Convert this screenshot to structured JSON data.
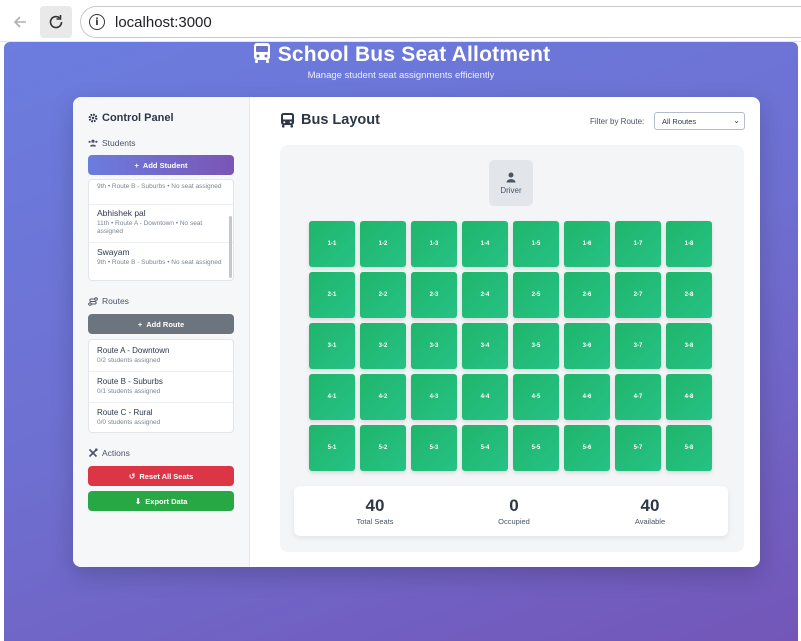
{
  "browser": {
    "url": "localhost:3000"
  },
  "header": {
    "title": "School Bus Seat Allotment",
    "subtitle": "Manage student seat assignments efficiently"
  },
  "sidebar": {
    "title": "Control Panel",
    "students_label": "Students",
    "add_student_label": "Add Student",
    "students": [
      {
        "name": "",
        "meta": "9th • Route B - Suburbs • No seat assigned"
      },
      {
        "name": "Abhishek pal",
        "meta": "11th • Route A - Downtown • No seat assigned"
      },
      {
        "name": "Swayam",
        "meta": "9th • Route B - Suburbs • No seat assigned"
      }
    ],
    "routes_label": "Routes",
    "add_route_label": "Add Route",
    "routes": [
      {
        "name": "Route A - Downtown",
        "meta": "0/2 students assigned"
      },
      {
        "name": "Route B - Suburbs",
        "meta": "0/1 students assigned"
      },
      {
        "name": "Route C - Rural",
        "meta": "0/0 students assigned"
      }
    ],
    "actions_label": "Actions",
    "reset_label": "Reset All Seats",
    "export_label": "Export Data"
  },
  "main": {
    "title": "Bus Layout",
    "filter_label": "Filter by Route:",
    "filter_value": "All Routes",
    "driver_label": "Driver",
    "seats": [
      [
        "1-1",
        "1-2",
        "1-3",
        "1-4",
        "1-5",
        "1-6",
        "1-7",
        "1-8"
      ],
      [
        "2-1",
        "2-2",
        "2-3",
        "2-4",
        "2-5",
        "2-6",
        "2-7",
        "2-8"
      ],
      [
        "3-1",
        "3-2",
        "3-3",
        "3-4",
        "3-5",
        "3-6",
        "3-7",
        "3-8"
      ],
      [
        "4-1",
        "4-2",
        "4-3",
        "4-4",
        "4-5",
        "4-6",
        "4-7",
        "4-8"
      ],
      [
        "5-1",
        "5-2",
        "5-3",
        "5-4",
        "5-5",
        "5-6",
        "5-7",
        "5-8"
      ]
    ],
    "stats": {
      "total_value": "40",
      "total_label": "Total Seats",
      "occupied_value": "0",
      "occupied_label": "Occupied",
      "available_value": "40",
      "available_label": "Available"
    }
  },
  "colors": {
    "seat_available": "#22bb77",
    "reset_button": "#dc3545",
    "export_button": "#28a745",
    "route_button": "#6c757d",
    "gradient_start": "#6b7ddf",
    "gradient_end": "#7356b8"
  }
}
